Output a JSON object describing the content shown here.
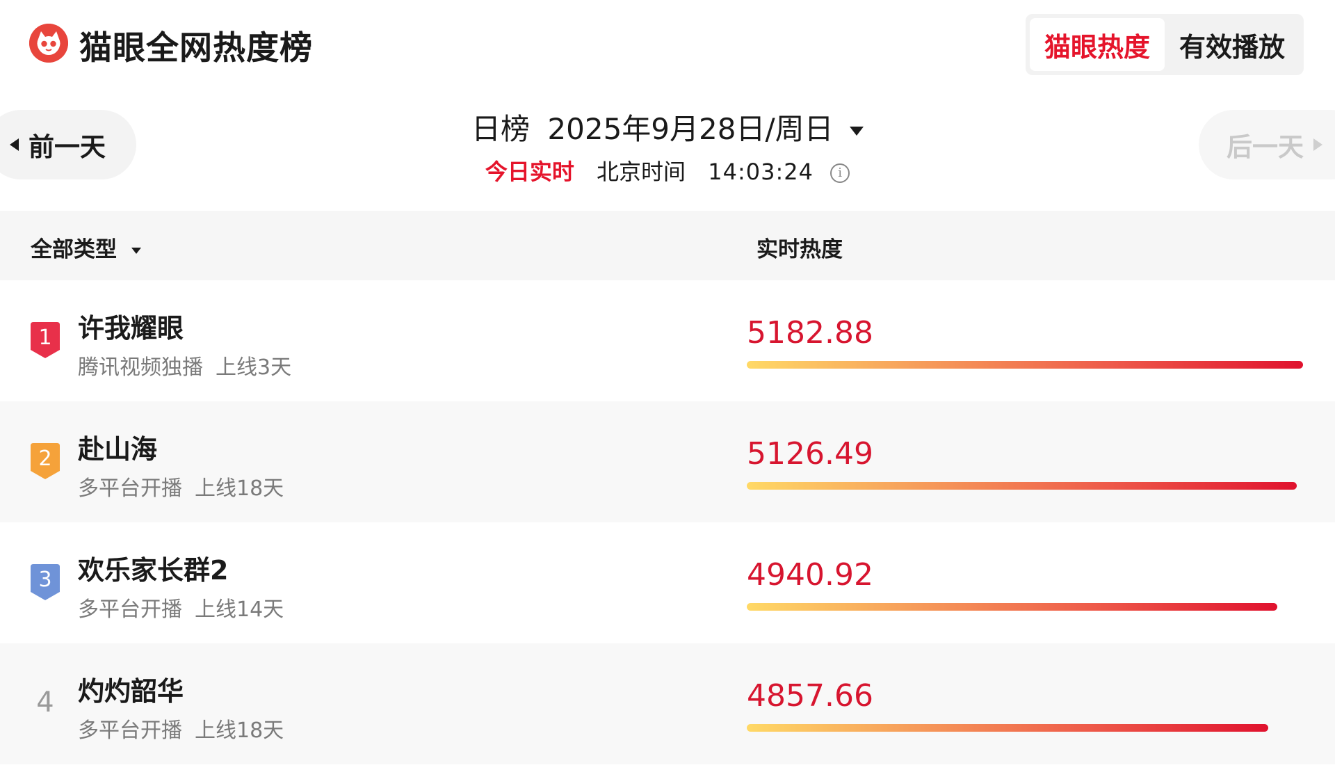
{
  "header": {
    "app_title": "猫眼全网热度榜",
    "tabs": [
      {
        "label": "猫眼热度",
        "active": true
      },
      {
        "label": "有效播放",
        "active": false
      }
    ]
  },
  "date_nav": {
    "prev_label": "前一天",
    "next_label": "后一天",
    "next_enabled": false,
    "range_label": "日榜",
    "date": "2025年9月28日/周日",
    "live_label": "今日实时",
    "timezone_label": "北京时间",
    "time": "14:03:24"
  },
  "table": {
    "filter_label": "全部类型",
    "heat_column_label": "实时热度",
    "max_heat": 5182.88,
    "rows": [
      {
        "rank": "1",
        "title": "许我耀眼",
        "platform": "腾讯视频独播",
        "online": "上线3天",
        "heat": "5182.88",
        "badge_color": "#e8304a"
      },
      {
        "rank": "2",
        "title": "赴山海",
        "platform": "多平台开播",
        "online": "上线18天",
        "heat": "5126.49",
        "badge_color": "#f5a23a"
      },
      {
        "rank": "3",
        "title": "欢乐家长群2",
        "platform": "多平台开播",
        "online": "上线14天",
        "heat": "4940.92",
        "badge_color": "#6f93d8"
      },
      {
        "rank": "4",
        "title": "灼灼韶华",
        "platform": "多平台开播",
        "online": "上线18天",
        "heat": "4857.66",
        "badge_color": null
      }
    ]
  },
  "colors": {
    "accent_red": "#e5142b",
    "heat_value": "#d7152f",
    "logo_red": "#e8453c"
  },
  "icons": {
    "logo": "maoyan-cat-logo",
    "info": "info-icon"
  }
}
